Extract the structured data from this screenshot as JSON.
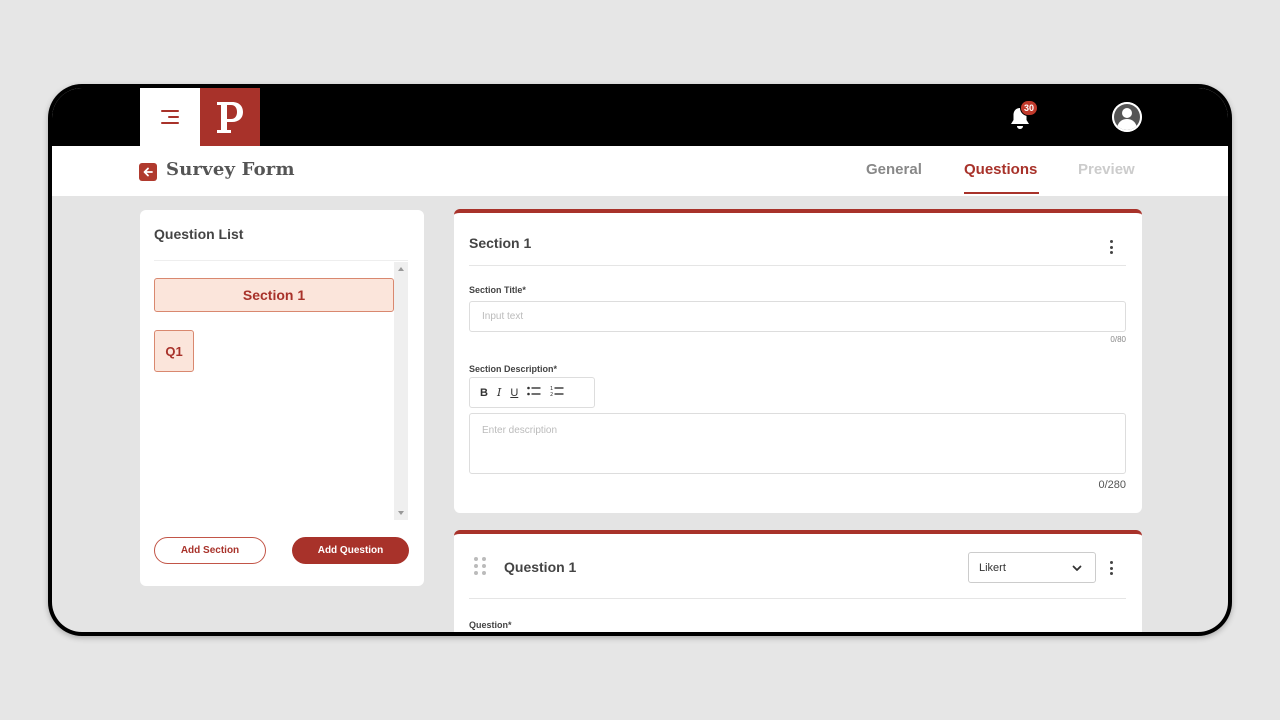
{
  "header": {
    "page_title": "Survey Form",
    "tabs": [
      {
        "label": "General",
        "state": "default"
      },
      {
        "label": "Questions",
        "state": "active"
      },
      {
        "label": "Preview",
        "state": "disabled"
      }
    ]
  },
  "topbar": {
    "logo_letter": "P",
    "notification_count": "30"
  },
  "question_list": {
    "title": "Question List",
    "items": [
      {
        "label": "Section 1",
        "kind": "section"
      },
      {
        "label": "Q1",
        "kind": "question"
      }
    ],
    "add_section_label": "Add Section",
    "add_question_label": "Add Question"
  },
  "section_card": {
    "heading": "Section 1",
    "title_label": "Section Title*",
    "title_placeholder": "Input text",
    "title_counter": "0/80",
    "description_label": "Section Description*",
    "toolbar": {
      "bold": "B",
      "italic": "I",
      "underline": "U"
    },
    "description_placeholder": "Enter description",
    "description_counter": "0/280"
  },
  "question_card": {
    "heading": "Question 1",
    "type_value": "Likert",
    "question_label": "Question*"
  },
  "colors": {
    "brand": "#a8322a",
    "chip_bg": "#fbe5db",
    "topbar": "#000000"
  }
}
